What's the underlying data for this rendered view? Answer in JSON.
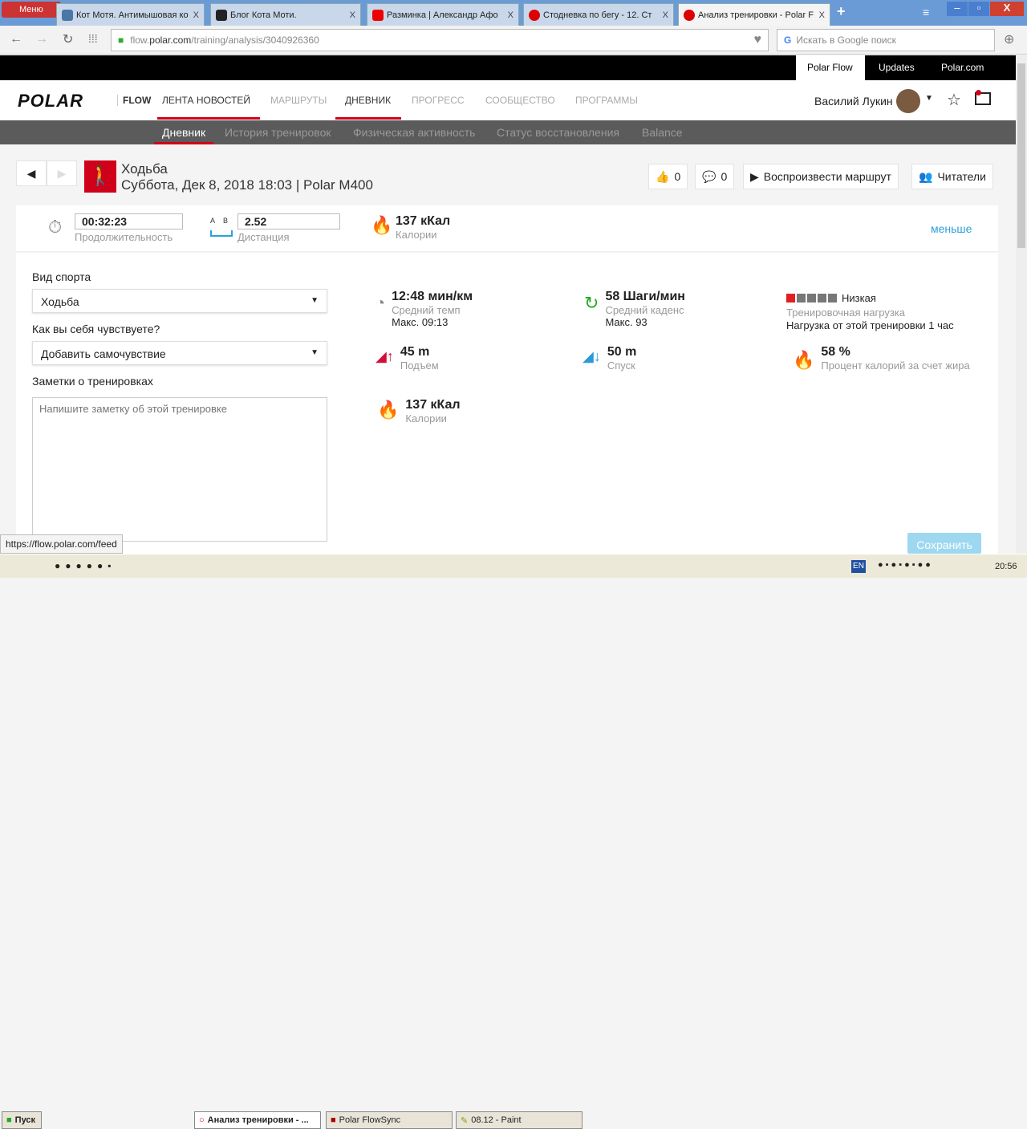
{
  "browser": {
    "menu": "Меню",
    "tabs": [
      {
        "title": "Кот Мотя. Антимышовая ко",
        "color": "#4a76a8"
      },
      {
        "title": "Блог Кота Моти.",
        "color": "#222"
      },
      {
        "title": "Разминка | Александр Афо",
        "color": "#e00"
      },
      {
        "title": "Стодневка по бегу - 12. Ст",
        "color": "#d00"
      },
      {
        "title": "Анализ тренировки - Polar F",
        "color": "#d00"
      }
    ],
    "tab_close": "X",
    "url_pre": "flow.",
    "url_domain": "polar.com",
    "url_path": "/training/analysis/3040926360",
    "search_placeholder": "Искать в Google поиск"
  },
  "topbar": {
    "links": [
      "Polar Flow",
      "Updates",
      "Polar.com"
    ]
  },
  "nav": {
    "logo": "POLAR",
    "flow": "FLOW",
    "items": [
      "ЛЕНТА НОВОСТЕЙ",
      "МАРШРУТЫ",
      "ДНЕВНИК",
      "ПРОГРЕСС",
      "СООБЩЕСТВО",
      "ПРОГРАММЫ"
    ],
    "user": "Василий Лукин"
  },
  "subnav": [
    "Дневник",
    "История тренировок",
    "Физическая активность",
    "Статус восстановления",
    "Balance"
  ],
  "session": {
    "sport": "Ходьба",
    "datetime": "Суббота, Дек 8, 2018 18:03 | Polar M400",
    "likes": "0",
    "comments": "0",
    "replay": "Воспроизвести маршрут",
    "readers": "Читатели"
  },
  "summary": {
    "duration": "00:32:23",
    "duration_label": "Продолжительность",
    "ab": "A B",
    "distance": "2.52",
    "distance_label": "Дистанция",
    "calories": "137 кКал",
    "calories_label": "Калории",
    "less": "меньше"
  },
  "form": {
    "sport_label": "Вид спорта",
    "sport_value": "Ходьба",
    "feel_label": "Как вы себя чувствуете?",
    "feel_value": "Добавить самочувствие",
    "notes_label": "Заметки о тренировках",
    "notes_placeholder": "Напишите заметку об этой тренировке",
    "save": "Сохранить"
  },
  "stats": {
    "pace": "12:48 мин/км",
    "pace_label": "Средний темп",
    "pace_max": "Макс. 09:13",
    "cadence": "58 Шаги/мин",
    "cadence_label": "Средний каденс",
    "cadence_max": "Макс. 93",
    "load_level": "Низкая",
    "load_level_fraction": 0.2,
    "load_label": "Тренировочная нагрузка",
    "load_desc": "Нагрузка от этой тренировки 1 час",
    "ascent": "45 m",
    "ascent_label": "Подъем",
    "descent": "50 m",
    "descent_label": "Спуск",
    "fat": "58 %",
    "fat_label": "Процент калорий за счет жира",
    "calories": "137 кКал",
    "calories_label": "Калории"
  },
  "status_url": "https://flow.polar.com/feed",
  "taskbar": {
    "start": "Пуск",
    "items": [
      "Анализ тренировки - ...",
      "Polar FlowSync",
      "08.12 - Paint"
    ],
    "lang": "EN",
    "time": "20:56"
  }
}
